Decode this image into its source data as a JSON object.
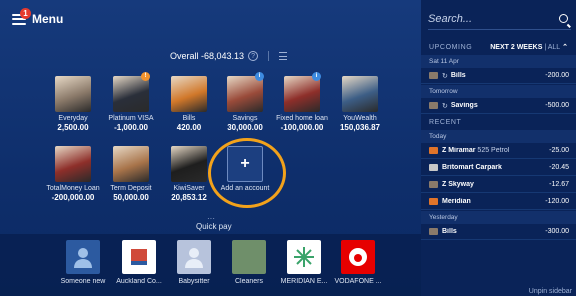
{
  "header": {
    "menu_label": "Menu",
    "notification_count": "1",
    "overall_label": "Overall -68,043.13",
    "help_symbol": "?"
  },
  "accounts": [
    {
      "name": "Everyday",
      "value": "2,500.00",
      "theme": "#8b7a6a"
    },
    {
      "name": "Platinum VISA",
      "value": "-1,000.00",
      "theme": "#2a2f3a",
      "badge": "!",
      "badge_color": "orange"
    },
    {
      "name": "Bills",
      "value": "420.00",
      "theme": "#d1782a"
    },
    {
      "name": "Savings",
      "value": "30,000.00",
      "theme": "#9a4b3a",
      "badge": "i",
      "badge_color": "blue"
    },
    {
      "name": "Fixed home loan",
      "value": "-100,000.00",
      "theme": "#8e2f2a",
      "badge": "i",
      "badge_color": "blue"
    },
    {
      "name": "YouWealth",
      "value": "150,036.87",
      "theme": "#3d5e86"
    },
    {
      "name": "TotalMoney Loan",
      "value": "-200,000.00",
      "theme": "#8e2f2a"
    },
    {
      "name": "Term Deposit",
      "value": "50,000.00",
      "theme": "#a8744a"
    },
    {
      "name": "KiwiSaver",
      "value": "20,853.12",
      "theme": "#1e1e1e"
    }
  ],
  "add_account": {
    "label": "Add an account",
    "symbol": "+"
  },
  "quick_pay": {
    "label": "Quick pay",
    "items": [
      {
        "name": "Someone new",
        "bg": "#2c5aa0"
      },
      {
        "name": "Auckland Co...",
        "bg": "#ffffff"
      },
      {
        "name": "Babysitter",
        "bg": "#b7c3dc"
      },
      {
        "name": "Cleaners",
        "bg": "#6f8f6a"
      },
      {
        "name": "MERIDIAN E...",
        "bg": "#ffffff"
      },
      {
        "name": "VODAFONE ...",
        "bg": "#e60000"
      }
    ]
  },
  "sidebar": {
    "search_placeholder": "Search...",
    "upcoming_label": "UPCOMING",
    "range_label": "NEXT 2 WEEKS",
    "all_label": "| ALL",
    "recent_label": "RECENT",
    "upcoming": [
      {
        "date": "Sat 11 Apr",
        "name": "Bills",
        "amount": "-200.00",
        "repeat": true
      },
      {
        "date": "Tomorrow",
        "name": "Savings",
        "amount": "-500.00",
        "repeat": true
      }
    ],
    "recent_groups": [
      {
        "date": "Today",
        "items": [
          {
            "name": "Z Miramar",
            "sub": "525 Petrol",
            "amount": "-25.00",
            "icon_color": "#e0742a"
          },
          {
            "name": "Britomart Carpark",
            "sub": "",
            "amount": "-20.45",
            "icon_color": "#c8c8c8"
          },
          {
            "name": "Z Skyway",
            "sub": "",
            "amount": "-12.67",
            "icon_color": "#8a7a6a"
          },
          {
            "name": "Meridian",
            "sub": "",
            "amount": "-120.00",
            "icon_color": "#e0742a"
          }
        ]
      },
      {
        "date": "Yesterday",
        "items": [
          {
            "name": "Bills",
            "sub": "",
            "amount": "-300.00",
            "icon_color": "#8a7a6a"
          }
        ]
      }
    ],
    "unpin_label": "Unpin sidebar"
  }
}
